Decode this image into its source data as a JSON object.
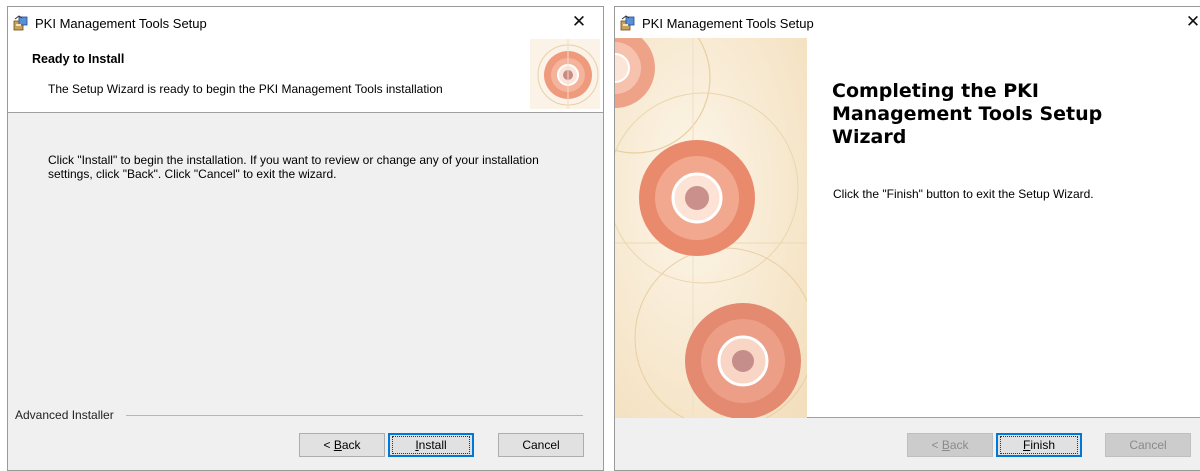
{
  "setup_dialog": {
    "title": "PKI Management Tools Setup",
    "close_glyph": "✕",
    "banner": {
      "heading": "Ready to Install",
      "subheading": "The Setup Wizard is ready to begin the PKI Management Tools installation"
    },
    "instructions": "Click \"Install\" to begin the installation.  If you want to review or change any of your installation settings, click \"Back\".  Click \"Cancel\" to exit the wizard.",
    "brand": "Advanced Installer",
    "buttons": {
      "back_pre": "< ",
      "back_key": "B",
      "back_rest": "ack",
      "install_key": "I",
      "install_rest": "nstall",
      "cancel": "Cancel"
    }
  },
  "finish_dialog": {
    "title": "PKI Management Tools Setup",
    "close_glyph": "✕",
    "heading": "Completing the PKI Management Tools Setup Wizard",
    "message": "Click the \"Finish\" button to exit the Setup Wizard.",
    "buttons": {
      "back_pre": "< ",
      "back_key": "B",
      "back_rest": "ack",
      "finish_key": "F",
      "finish_rest": "inish",
      "cancel": "Cancel"
    }
  },
  "icons": {
    "app": "installer-box-icon",
    "close": "close-icon"
  },
  "colors": {
    "accent": "#0078d7",
    "dialog_bg": "#f0f0f0",
    "art_rose": "#e8876a",
    "art_cream": "#f6e6c6"
  }
}
